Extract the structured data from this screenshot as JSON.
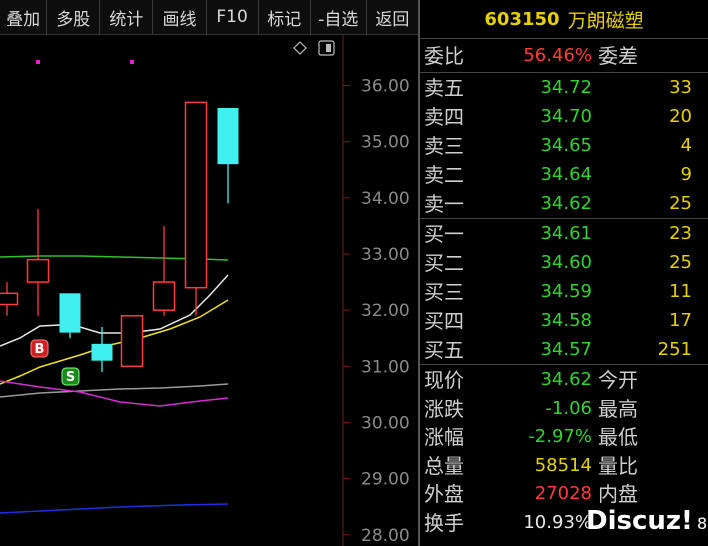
{
  "toolbar": {
    "buttons": [
      "叠加",
      "多股",
      "统计",
      "画线",
      "F10",
      "标记",
      "-自选",
      "返回"
    ]
  },
  "chart": {
    "price_axis_labels": [
      "36.00",
      "35.00",
      "34.00",
      "33.00",
      "32.00",
      "31.00",
      "30.00",
      "29.00",
      "28.00"
    ],
    "buy_marker": "B",
    "sell_marker": "S",
    "colors": {
      "up": "#ff3b3b",
      "down": "#40f0f0",
      "ma_white": "#e8e8e8",
      "ma_yellow": "#f0e020",
      "ma_purple": "#d030d0",
      "ma_green": "#30c030",
      "ma_gray": "#9a9a9a",
      "ma_blue": "#2030e0"
    }
  },
  "chart_data": {
    "type": "candlestick",
    "ylim": [
      27.8,
      36.9
    ],
    "candles": [
      {
        "open": 32.1,
        "close": 32.3,
        "high": 32.5,
        "low": 31.9,
        "dir": "up"
      },
      {
        "open": 32.5,
        "close": 32.9,
        "high": 33.8,
        "low": 31.9,
        "dir": "up"
      },
      {
        "open": 32.3,
        "close": 31.6,
        "high": 32.3,
        "low": 31.5,
        "dir": "down"
      },
      {
        "open": 31.4,
        "close": 31.1,
        "high": 31.7,
        "low": 30.9,
        "dir": "down"
      },
      {
        "open": 31.0,
        "close": 31.9,
        "high": 31.9,
        "low": 31.0,
        "dir": "up"
      },
      {
        "open": 32.0,
        "close": 32.5,
        "high": 33.5,
        "low": 31.9,
        "dir": "up"
      },
      {
        "open": 32.4,
        "close": 35.7,
        "high": 35.7,
        "low": 31.9,
        "dir": "up"
      },
      {
        "open": 35.6,
        "close": 34.6,
        "high": 35.6,
        "low": 33.9,
        "dir": "down"
      }
    ]
  },
  "quote": {
    "code": "603150",
    "name": "万朗磁塑",
    "weibi_label": "委比",
    "weibi_value": "56.46%",
    "weicha_label": "委差",
    "asks": [
      {
        "label": "卖五",
        "price": "34.72",
        "vol": "33"
      },
      {
        "label": "卖四",
        "price": "34.70",
        "vol": "20"
      },
      {
        "label": "卖三",
        "price": "34.65",
        "vol": "4"
      },
      {
        "label": "卖二",
        "price": "34.64",
        "vol": "9"
      },
      {
        "label": "卖一",
        "price": "34.62",
        "vol": "25"
      }
    ],
    "bids": [
      {
        "label": "买一",
        "price": "34.61",
        "vol": "23"
      },
      {
        "label": "买二",
        "price": "34.60",
        "vol": "25"
      },
      {
        "label": "买三",
        "price": "34.59",
        "vol": "11"
      },
      {
        "label": "买四",
        "price": "34.58",
        "vol": "17"
      },
      {
        "label": "买五",
        "price": "34.57",
        "vol": "251"
      }
    ],
    "stats": [
      {
        "label": "现价",
        "value": "34.62",
        "color": "green",
        "label2": "今开"
      },
      {
        "label": "涨跌",
        "value": "-1.06",
        "color": "green",
        "label2": "最高"
      },
      {
        "label": "涨幅",
        "value": "-2.97%",
        "color": "green",
        "label2": "最低"
      },
      {
        "label": "总量",
        "value": "58514",
        "color": "yellow",
        "label2": "量比"
      },
      {
        "label": "外盘",
        "value": "27028",
        "color": "red",
        "label2": "内盘"
      },
      {
        "label": "换手",
        "value": "10.93%",
        "color": "white",
        "label2": ""
      }
    ]
  },
  "watermark": {
    "text": "Discuz!",
    "tail": "8"
  }
}
